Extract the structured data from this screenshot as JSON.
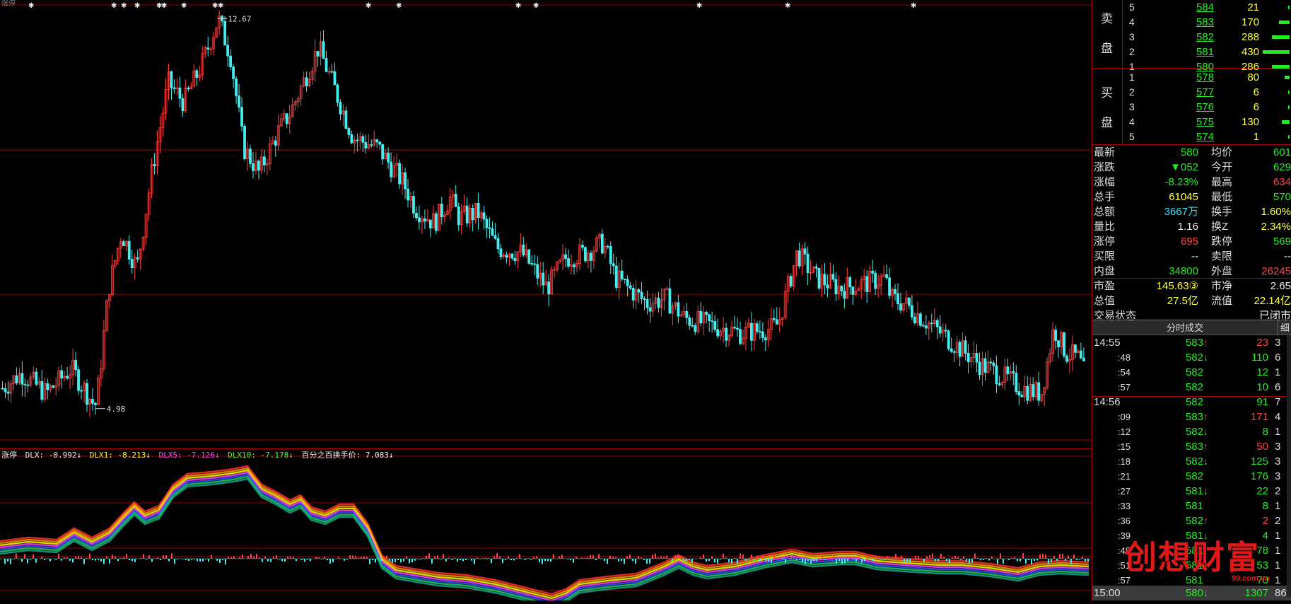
{
  "main_chart": {
    "title": "涨停",
    "high_label": "12.67",
    "low_label": "4.98",
    "candle_colors": {
      "up": "#ff4040",
      "down": "#44eeee"
    },
    "grid_color": "#a00000"
  },
  "indicator": {
    "labels": [
      {
        "text": "DLX: -0.992↓",
        "color": "#eeeeee"
      },
      {
        "text": "DLX1: -8.213↓",
        "color": "#ffff33"
      },
      {
        "text": "DLX5: -7.126↓",
        "color": "#ff44ff"
      },
      {
        "text": "DLX10: -7.178↓",
        "color": "#33ff33"
      },
      {
        "text": "百分之百换手价: 7.083↓",
        "color": "#eeeeee"
      }
    ],
    "name": "涨停"
  },
  "order_book": {
    "sell_label_1": "卖",
    "sell_label_2": "盘",
    "buy_label_1": "买",
    "buy_label_2": "盘",
    "sells": [
      {
        "level": "5",
        "price": "584",
        "volume": "21"
      },
      {
        "level": "4",
        "price": "583",
        "volume": "170"
      },
      {
        "level": "3",
        "price": "582",
        "volume": "288"
      },
      {
        "level": "2",
        "price": "581",
        "volume": "430"
      },
      {
        "level": "1",
        "price": "580",
        "volume": "286"
      }
    ],
    "buys": [
      {
        "level": "1",
        "price": "578",
        "volume": "80"
      },
      {
        "level": "2",
        "price": "577",
        "volume": "6"
      },
      {
        "level": "3",
        "price": "576",
        "volume": "6"
      },
      {
        "level": "4",
        "price": "575",
        "volume": "130"
      },
      {
        "level": "5",
        "price": "574",
        "volume": "1"
      }
    ]
  },
  "quote": {
    "rows": [
      {
        "k": "最新",
        "v": "580",
        "vc": "green",
        "k2": "均价",
        "v2": "601",
        "v2c": "green"
      },
      {
        "k": "涨跌",
        "v": "▼052",
        "vc": "green",
        "k2": "今开",
        "v2": "629",
        "v2c": "green"
      },
      {
        "k": "涨幅",
        "v": "-8.23%",
        "vc": "green",
        "k2": "最高",
        "v2": "634",
        "v2c": "red"
      },
      {
        "k": "总手",
        "v": "61045",
        "vc": "yellow",
        "k2": "最低",
        "v2": "570",
        "v2c": "green"
      },
      {
        "k": "总额",
        "v": "3667万",
        "vc": "cyan",
        "k2": "换手",
        "v2": "1.60%",
        "v2c": "yellow"
      },
      {
        "k": "量比",
        "v": "1.16",
        "vc": "white",
        "k2": "换Z",
        "v2": "2.34%",
        "v2c": "yellow"
      },
      {
        "k": "涨停",
        "v": "695",
        "vc": "red",
        "k2": "跌停",
        "v2": "569",
        "v2c": "green"
      },
      {
        "k": "买限",
        "v": "--",
        "vc": "white",
        "k2": "卖限",
        "v2": "--",
        "v2c": "white"
      },
      {
        "k": "内盘",
        "v": "34800",
        "vc": "green",
        "k2": "外盘",
        "v2": "26245",
        "v2c": "red"
      },
      {
        "k": "市盈",
        "v": "145.63③",
        "vc": "yellow",
        "k2": "市净",
        "v2": "2.65",
        "v2c": "white"
      },
      {
        "k": "总值",
        "v": "27.5亿",
        "vc": "yellow",
        "k2": "流值",
        "v2": "22.14亿",
        "v2c": "yellow"
      },
      {
        "k": "交易状态",
        "v": "",
        "vc": "white",
        "k2": "",
        "v2": "已闭市",
        "v2c": "white"
      }
    ]
  },
  "ticks": {
    "header": "分时成交",
    "detail": "细",
    "rows": [
      {
        "t": "14:55",
        "p": "583",
        "a": "↑",
        "ac": "up",
        "v": "23",
        "vc": "red",
        "n": "3"
      },
      {
        "t": ":48",
        "p": "582",
        "a": "↓",
        "ac": "dn",
        "v": "110",
        "vc": "green",
        "n": "6"
      },
      {
        "t": ":54",
        "p": "582",
        "a": "",
        "ac": "",
        "v": "12",
        "vc": "green",
        "n": "1"
      },
      {
        "t": ":57",
        "p": "582",
        "a": "",
        "ac": "",
        "v": "10",
        "vc": "green",
        "n": "6"
      },
      {
        "t": "14:56",
        "p": "582",
        "a": "",
        "ac": "",
        "v": "91",
        "vc": "green",
        "n": "7"
      },
      {
        "t": ":09",
        "p": "583",
        "a": "↑",
        "ac": "up",
        "v": "171",
        "vc": "red",
        "n": "4"
      },
      {
        "t": ":12",
        "p": "582",
        "a": "↓",
        "ac": "dn",
        "v": "8",
        "vc": "green",
        "n": "1"
      },
      {
        "t": ":15",
        "p": "583",
        "a": "↑",
        "ac": "up",
        "v": "50",
        "vc": "red",
        "n": "3"
      },
      {
        "t": ":18",
        "p": "582",
        "a": "↓",
        "ac": "dn",
        "v": "125",
        "vc": "green",
        "n": "3"
      },
      {
        "t": ":21",
        "p": "582",
        "a": "",
        "ac": "",
        "v": "176",
        "vc": "green",
        "n": "3"
      },
      {
        "t": ":27",
        "p": "581",
        "a": "↓",
        "ac": "dn",
        "v": "22",
        "vc": "green",
        "n": "2"
      },
      {
        "t": ":33",
        "p": "581",
        "a": "",
        "ac": "",
        "v": "8",
        "vc": "green",
        "n": "1"
      },
      {
        "t": ":36",
        "p": "582",
        "a": "↑",
        "ac": "up",
        "v": "2",
        "vc": "red",
        "n": "2"
      },
      {
        "t": ":39",
        "p": "581",
        "a": "↓",
        "ac": "dn",
        "v": "4",
        "vc": "green",
        "n": "1"
      },
      {
        "t": ":48",
        "p": "581",
        "a": "",
        "ac": "",
        "v": "78",
        "vc": "green",
        "n": "1"
      },
      {
        "t": ":51",
        "p": "581",
        "a": "↓",
        "ac": "dn",
        "v": "53",
        "vc": "green",
        "n": "1"
      },
      {
        "t": ":57",
        "p": "581",
        "a": "",
        "ac": "",
        "v": "70",
        "vc": "green",
        "n": "1"
      },
      {
        "t": "15:00",
        "p": "580",
        "a": "↓",
        "ac": "dn",
        "v": "1307",
        "vc": "green",
        "n": "86"
      }
    ]
  },
  "watermark": {
    "text": "创想财富",
    "url": "99.com.cn"
  }
}
